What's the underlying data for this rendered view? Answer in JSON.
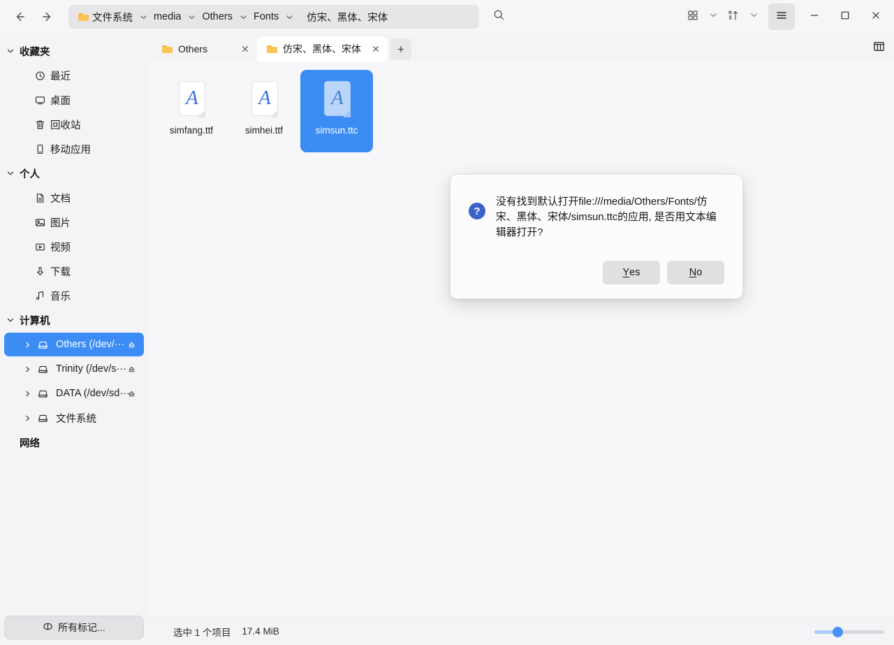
{
  "titlebar": {
    "back_label": "←",
    "forward_label": "→",
    "breadcrumbs": [
      {
        "label": "文件系统",
        "has_folder_icon": true,
        "has_chevron": true
      },
      {
        "label": "media",
        "has_folder_icon": false,
        "has_chevron": true
      },
      {
        "label": "Others",
        "has_folder_icon": false,
        "has_chevron": true
      },
      {
        "label": "Fonts",
        "has_folder_icon": false,
        "has_chevron": true
      },
      {
        "label": "仿宋、黑体、宋体",
        "has_folder_icon": false,
        "has_chevron": false
      }
    ],
    "search_icon": "search-icon",
    "view_icon": "grid-view-icon",
    "sort_icon": "sort-ascending-icon",
    "menu_icon": "hamburger-menu-icon",
    "minimize_label": "−",
    "maximize_label": "□",
    "close_label": "✕"
  },
  "sidebar": {
    "groups": [
      {
        "name": "收藏夹",
        "expanded": true,
        "items": [
          {
            "label": "最近",
            "icon": "clock-icon"
          },
          {
            "label": "桌面",
            "icon": "monitor-icon"
          },
          {
            "label": "回收站",
            "icon": "trash-icon"
          },
          {
            "label": "移动应用",
            "icon": "mobile-app-icon"
          }
        ]
      },
      {
        "name": "个人",
        "expanded": true,
        "items": [
          {
            "label": "文档",
            "icon": "document-icon"
          },
          {
            "label": "图片",
            "icon": "image-icon"
          },
          {
            "label": "视频",
            "icon": "video-icon"
          },
          {
            "label": "下载",
            "icon": "download-icon"
          },
          {
            "label": "音乐",
            "icon": "music-icon"
          }
        ]
      },
      {
        "name": "计算机",
        "expanded": true,
        "drives": [
          {
            "label": "Others (/dev/···",
            "icon": "drive-icon",
            "selected": true,
            "eject": true
          },
          {
            "label": "Trinity (/dev/s···",
            "icon": "drive-icon",
            "selected": false,
            "eject": true
          },
          {
            "label": "DATA (/dev/sd···",
            "icon": "drive-icon",
            "selected": false,
            "eject": true
          },
          {
            "label": "文件系统",
            "icon": "drive-icon",
            "selected": false,
            "eject": false
          }
        ]
      }
    ],
    "network_label": "网络",
    "tags_button": {
      "label": "所有标记...",
      "icon": "tag-icon"
    },
    "selected_color": "#3b8cf5"
  },
  "tabs": {
    "items": [
      {
        "label": "Others",
        "active": false
      },
      {
        "label": "仿宋、黑体、宋体",
        "active": true
      }
    ],
    "add_label": "+",
    "panel_toggle_icon": "split-view-icon"
  },
  "files": [
    {
      "name": "simfang.ttf",
      "glyph": "A",
      "selected": false
    },
    {
      "name": "simhei.ttf",
      "glyph": "A",
      "selected": false
    },
    {
      "name": "simsun.ttc",
      "glyph": "A",
      "selected": true
    }
  ],
  "statusbar": {
    "selection_text": "选中 1 个项目",
    "size_text": "17.4 MiB",
    "zoom_percent": 33
  },
  "dialog": {
    "icon": "question-mark-icon",
    "message": "没有找到默认打开file:///media/Others/Fonts/仿宋、黑体、宋体/simsun.ttc的应用, 是否用文本编辑器打开?",
    "yes_label": "Yes",
    "yes_mnemonic": "Y",
    "no_label": "No",
    "no_mnemonic": "N",
    "accent_color": "#3b62c9"
  }
}
